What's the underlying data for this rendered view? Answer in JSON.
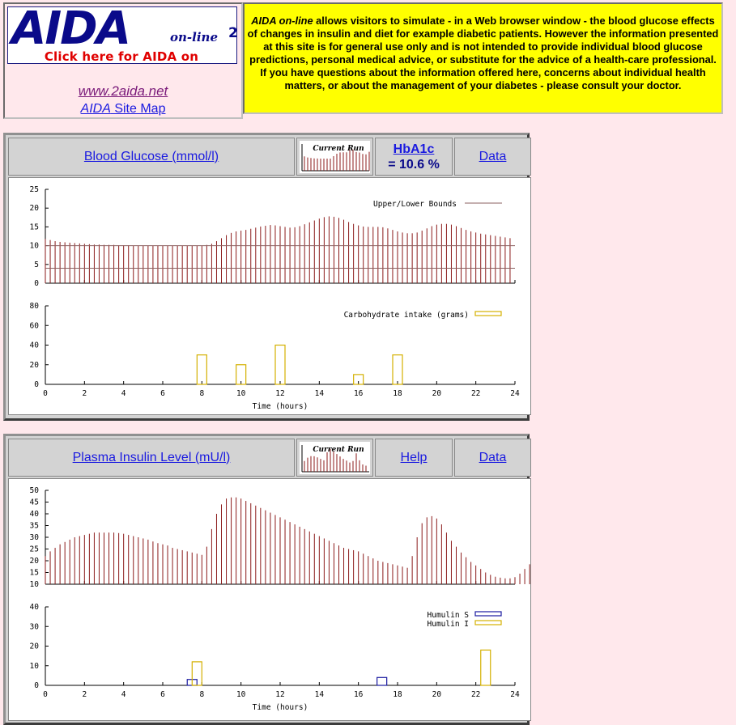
{
  "header": {
    "logo_text": "AIDA",
    "logo_online": "on-line",
    "logo_sup": "2",
    "facebook_link": "Click here for AIDA on Facebook",
    "site_url": "www.2aida.net",
    "sitemap_italic": "AIDA",
    "sitemap_rest": " Site Map",
    "disclaimer_lead": "AIDA on-line",
    "disclaimer_text": " allows visitors to simulate - in a Web browser window - the blood glucose effects of changes in insulin and diet for example diabetic patients. However the information presented at this site is for general use only and is not intended to provide individual blood glucose predictions, personal medical advice, or substitute for the advice of a health-care professional. If you have questions about the information offered here, concerns about individual health matters, or about the management of your diabetes - please consult your doctor."
  },
  "glucose_panel": {
    "title_link": "Blood Glucose (mmol/l)",
    "thumb_label": "Current Run",
    "hba1c_link": "HbA1c",
    "hba1c_value": "= 10.6 %",
    "data_link": "Data"
  },
  "insulin_panel": {
    "title_link": "Plasma Insulin Level (mU/l)",
    "thumb_label": "Current Run",
    "help_link": "Help",
    "data_link": "Data"
  },
  "colors": {
    "bar_line": "#8b1a1a",
    "carb_bar": "#d4b000",
    "humulin_s": "#1a1aa0",
    "humulin_i": "#d4b000"
  },
  "chart_data": [
    {
      "type": "bar",
      "title": "",
      "ylabel": "",
      "ylim": [
        0,
        25
      ],
      "yticks": [
        "0",
        "5",
        "10",
        "15",
        "20",
        "25"
      ],
      "xlim": [
        0,
        24
      ],
      "legend": "top-right",
      "legend_label": "Upper/Lower Bounds",
      "bounds": [
        4,
        10
      ],
      "x_step_hours": 0.25,
      "series": [
        {
          "values": [
            11.8,
            11.5,
            11.2,
            11,
            10.9,
            10.8,
            10.7,
            10.6,
            10.5,
            10.4,
            10.3,
            10.3,
            10.2,
            10.2,
            10.2,
            10.1,
            10.1,
            10.1,
            10,
            10,
            10,
            10,
            10,
            10,
            10,
            10,
            10,
            10,
            10,
            10,
            10,
            10,
            10,
            10.2,
            10.5,
            11.2,
            12,
            12.8,
            13.4,
            13.8,
            14,
            14.2,
            14.5,
            14.8,
            15.1,
            15.3,
            15.5,
            15.4,
            15.2,
            15,
            14.8,
            14.9,
            15.2,
            15.7,
            16.2,
            16.7,
            17.2,
            17.6,
            17.8,
            17.7,
            17.4,
            16.9,
            16.3,
            15.8,
            15.4,
            15.1,
            15,
            15,
            15,
            14.9,
            14.6,
            14.2,
            13.8,
            13.5,
            13.3,
            13.3,
            13.5,
            14,
            14.6,
            15.2,
            15.6,
            15.8,
            15.8,
            15.6,
            15.2,
            14.7,
            14.2,
            13.8,
            13.5,
            13.2,
            13,
            12.8,
            12.6,
            12.4,
            12.2,
            12
          ]
        }
      ]
    },
    {
      "type": "bar",
      "xlabel": "Time (hours)",
      "ylim": [
        0,
        80
      ],
      "yticks": [
        "0",
        "20",
        "40",
        "60",
        "80"
      ],
      "xticks": [
        "0",
        "2",
        "4",
        "6",
        "8",
        "10",
        "12",
        "14",
        "16",
        "18",
        "20",
        "22",
        "24"
      ],
      "legend": "top-right",
      "series": [
        {
          "name": "Carbohydrate intake (grams)",
          "x": [
            8,
            10,
            12,
            16,
            18
          ],
          "values": [
            30,
            20,
            40,
            10,
            30
          ]
        }
      ]
    },
    {
      "type": "bar",
      "ylim": [
        10,
        50
      ],
      "yticks": [
        "10",
        "15",
        "20",
        "25",
        "30",
        "35",
        "40",
        "45",
        "50"
      ],
      "xlim": [
        0,
        24
      ],
      "x_step_hours": 0.25,
      "series": [
        {
          "values": [
            22,
            24,
            25.5,
            27,
            28,
            29,
            30,
            30.5,
            31,
            31.5,
            32,
            32,
            32,
            32,
            32,
            31.8,
            31.5,
            31,
            30.5,
            30,
            29.5,
            29,
            28.2,
            27.5,
            27,
            26.5,
            25.5,
            25,
            24.5,
            24,
            23.5,
            23,
            22.5,
            26,
            33.5,
            40,
            44,
            46.5,
            47,
            47,
            46.5,
            45.5,
            44.5,
            43.5,
            42.5,
            41.5,
            40.5,
            39.5,
            38.5,
            37.5,
            36.5,
            35.5,
            34.5,
            33.5,
            32.5,
            31.5,
            30.5,
            29.5,
            28.5,
            27.5,
            26.5,
            25.5,
            25,
            24.5,
            24,
            23,
            22,
            21,
            20,
            19.5,
            19,
            18.5,
            18,
            17.5,
            17,
            22,
            30,
            36,
            38.5,
            39,
            38,
            35.5,
            32,
            28.5,
            26,
            23.5,
            21.5,
            19.5,
            18,
            16.5,
            15,
            14,
            13.2,
            12.8,
            12.5,
            12.5,
            13,
            14.5,
            16.5,
            18.5
          ]
        }
      ]
    },
    {
      "type": "bar",
      "xlabel": "Time (hours)",
      "ylim": [
        0,
        40
      ],
      "yticks": [
        "0",
        "10",
        "20",
        "30",
        "40"
      ],
      "xticks": [
        "0",
        "2",
        "4",
        "6",
        "8",
        "10",
        "12",
        "14",
        "16",
        "18",
        "20",
        "22",
        "24"
      ],
      "legend": "top-right",
      "series": [
        {
          "name": "Humulin S",
          "x": [
            7.5,
            17.2
          ],
          "values": [
            3,
            4
          ]
        },
        {
          "name": "Humulin I",
          "x": [
            7.75,
            22.5
          ],
          "values": [
            12,
            18
          ]
        }
      ]
    }
  ]
}
